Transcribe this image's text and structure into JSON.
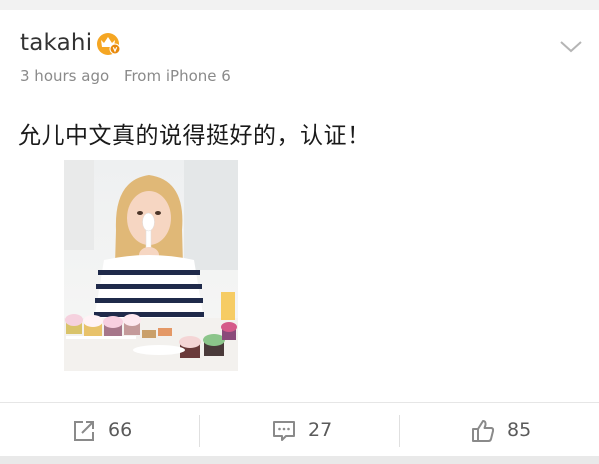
{
  "post": {
    "username": "takahi",
    "time": "3 hours ago",
    "source": "From iPhone 6",
    "text": "允儿中文真的说得挺好的，认证！"
  },
  "actions": {
    "repost_count": "66",
    "comment_count": "27",
    "like_count": "85"
  },
  "icons": {
    "badge": "vip-crown-badge",
    "menu": "chevron-down-icon",
    "repost": "share-out-icon",
    "comment": "comment-bubble-icon",
    "like": "thumbs-up-icon"
  },
  "colors": {
    "badge_orange": "#f5a623",
    "text_primary": "#1a1a1a",
    "text_secondary": "#8a8a8a"
  }
}
